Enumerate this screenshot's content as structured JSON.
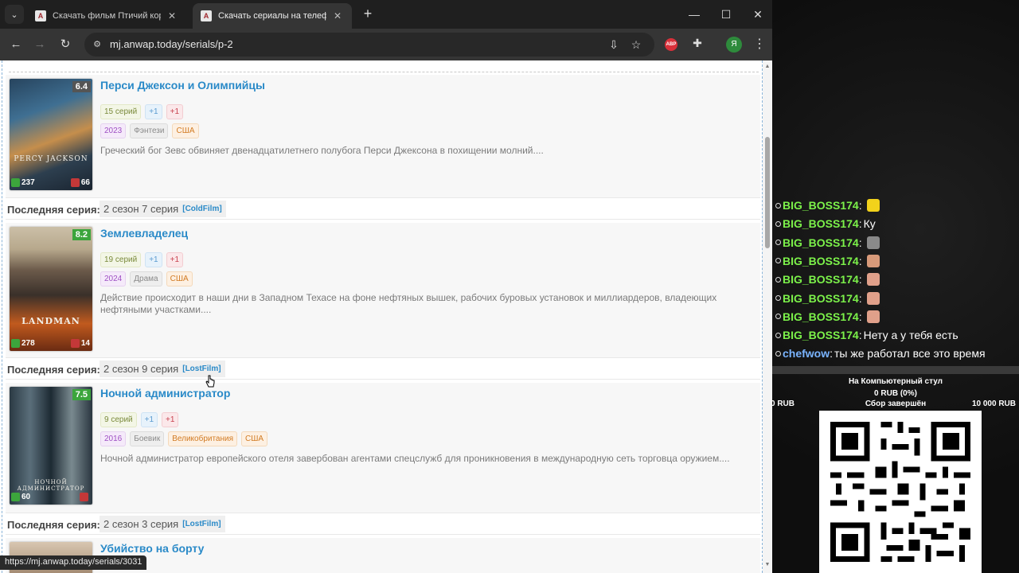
{
  "browser": {
    "tabs": [
      {
        "title": "Скачать фильм Птичий короб",
        "active": false
      },
      {
        "title": "Скачать сериалы на телефон",
        "active": true
      }
    ],
    "url": "mj.anwap.today/serials/p-2",
    "profile_initial": "Я",
    "ext_abp_label": "ABP",
    "status_url": "https://mj.anwap.today/serials/3031",
    "accent_link_color": "#2a8ac8"
  },
  "series": [
    {
      "title": "Перси Джексон и Олимпийцы",
      "rating": "6.4",
      "rating_color": "#555555",
      "likes": "237",
      "dislikes": "66",
      "episodes": "15 серий",
      "plus_blue": "+1",
      "plus_red": "+1",
      "year": "2023",
      "genres": [
        "Фэнтези"
      ],
      "countries": [
        "США"
      ],
      "description": "Греческий бог Зевс обвиняет двенадцатилетнего полубога Перси Джексона в похищении молний....",
      "poster_text": "PERCY JACKSON",
      "last_episode_label": "Последняя серия:",
      "last_episode": "2 сезон 7 серия",
      "studio": "[ColdFilm]"
    },
    {
      "title": "Землевладелец",
      "rating": "8.2",
      "rating_color": "#3ca53c",
      "likes": "278",
      "dislikes": "14",
      "episodes": "19 серий",
      "plus_blue": "+1",
      "plus_red": "+1",
      "year": "2024",
      "genres": [
        "Драма"
      ],
      "countries": [
        "США"
      ],
      "description": "Действие происходит в наши дни в Западном Техасе на фоне нефтяных вышек, рабочих буровых установок и миллиардеров, владеющих нефтяными участками....",
      "poster_text": "LANDMAN",
      "last_episode_label": "Последняя серия:",
      "last_episode": "2 сезон 9 серия",
      "studio": "[LostFilm]"
    },
    {
      "title": "Ночной администратор",
      "rating": "7.5",
      "rating_color": "#3ca53c",
      "likes": "60",
      "dislikes": "",
      "episodes": "9 серий",
      "plus_blue": "+1",
      "plus_red": "+1",
      "year": "2016",
      "genres": [
        "Боевик"
      ],
      "countries": [
        "Великобритания",
        "США"
      ],
      "description": "Ночной администратор европейского отеля завербован агентами спецслужб для проникновения в международную сеть торговца оружием....",
      "poster_text": "НОЧНОЙ АДМИНИСТРАТОР",
      "last_episode_label": "Последняя серия:",
      "last_episode": "2 сезон 3 серия",
      "studio": "[LostFilm]"
    },
    {
      "title": "Убийство на борту"
    }
  ],
  "chat": [
    {
      "user": "BIG_BOSS174",
      "message": "",
      "emote": "#f2d21b"
    },
    {
      "user": "BIG_BOSS174",
      "message": "Ку",
      "emote": ""
    },
    {
      "user": "BIG_BOSS174",
      "message": "",
      "emote": "#8a8a8a"
    },
    {
      "user": "BIG_BOSS174",
      "message": "",
      "emote": "#d89a7a"
    },
    {
      "user": "BIG_BOSS174",
      "message": "",
      "emote": "#e0a08a"
    },
    {
      "user": "BIG_BOSS174",
      "message": "",
      "emote": "#e0a08a"
    },
    {
      "user": "BIG_BOSS174",
      "message": "",
      "emote": "#e0a08a"
    },
    {
      "user": "BIG_BOSS174",
      "message": "Нету а у тебя есть",
      "emote": ""
    },
    {
      "user": "chefwow",
      "message": "ты же работал все это время",
      "emote": ""
    }
  ],
  "donation_goal": {
    "title": "На Компьютерный стул",
    "amount": "0 RUB (0%)",
    "progress": 0,
    "min": "0 RUB",
    "status": "Сбор завершён",
    "max": "10 000 RUB"
  }
}
